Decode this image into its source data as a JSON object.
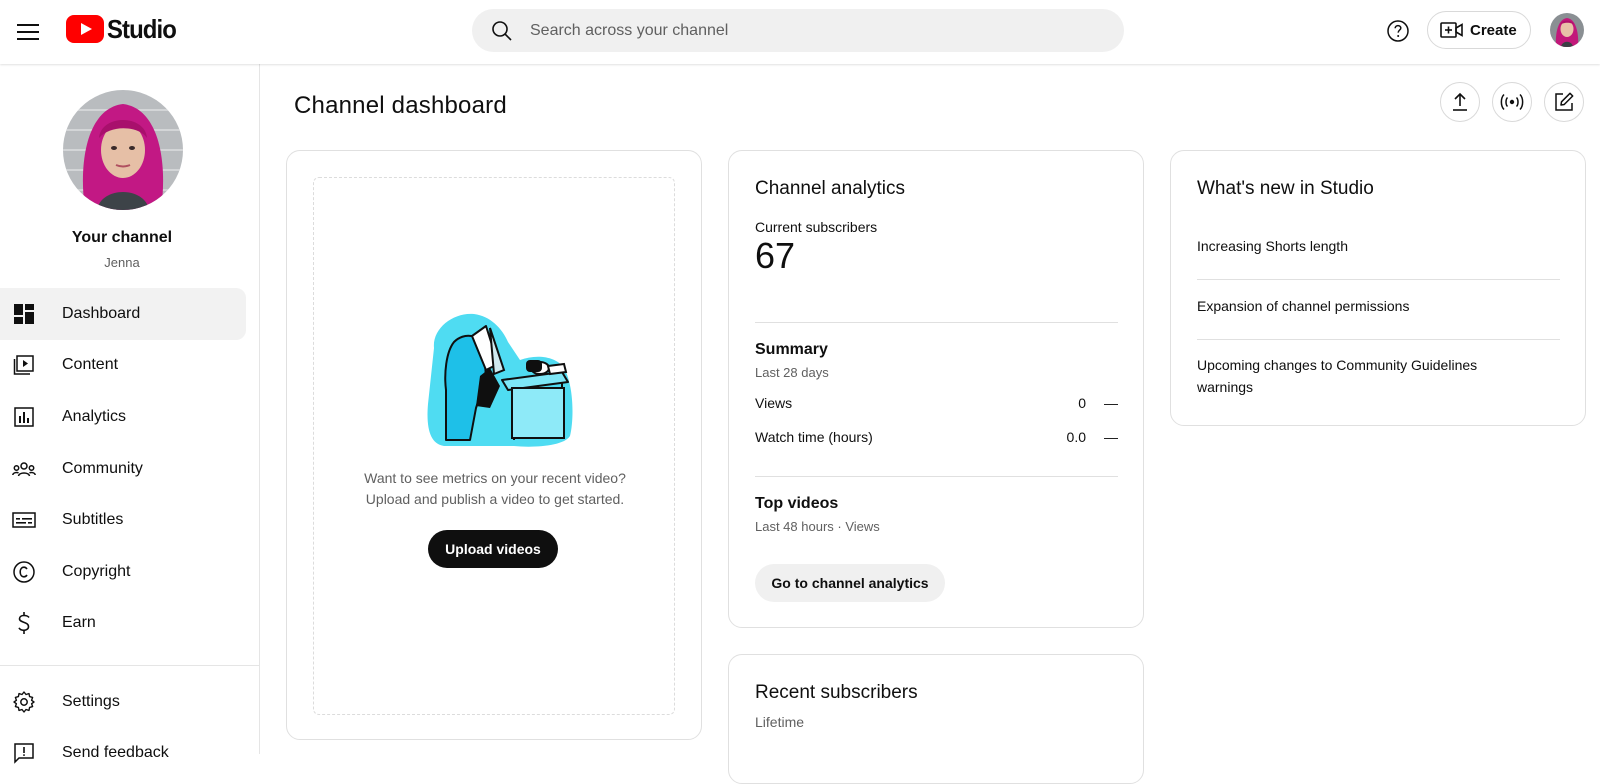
{
  "app": {
    "logo_text": "Studio",
    "brand_red": "#ff0000"
  },
  "search": {
    "placeholder": "Search across your channel"
  },
  "header": {
    "create_label": "Create"
  },
  "sidebar": {
    "channel_title": "Your channel",
    "channel_name": "Jenna",
    "items": [
      {
        "label": "Dashboard",
        "icon": "dashboard-icon",
        "active": true
      },
      {
        "label": "Content",
        "icon": "content-icon"
      },
      {
        "label": "Analytics",
        "icon": "analytics-icon"
      },
      {
        "label": "Community",
        "icon": "community-icon"
      },
      {
        "label": "Subtitles",
        "icon": "subtitles-icon"
      },
      {
        "label": "Copyright",
        "icon": "copyright-icon"
      },
      {
        "label": "Earn",
        "icon": "earn-icon"
      }
    ],
    "bottom_items": [
      {
        "label": "Settings",
        "icon": "gear-icon"
      },
      {
        "label": "Send feedback",
        "icon": "feedback-icon"
      }
    ]
  },
  "main": {
    "title": "Channel dashboard",
    "upload_card": {
      "message_line1": "Want to see metrics on your recent video?",
      "message_line2": "Upload and publish a video to get started.",
      "button": "Upload videos"
    },
    "analytics_card": {
      "title": "Channel analytics",
      "subscribers_label": "Current subscribers",
      "subscribers_value": "67",
      "summary_title": "Summary",
      "summary_period": "Last 28 days",
      "stats": [
        {
          "label": "Views",
          "value": "0",
          "delta": "—"
        },
        {
          "label": "Watch time (hours)",
          "value": "0.0",
          "delta": "—"
        }
      ],
      "top_videos_title": "Top videos",
      "top_videos_period": "Last 48 hours · Views",
      "button": "Go to channel analytics"
    },
    "recent_subscribers_card": {
      "title": "Recent subscribers",
      "period": "Lifetime"
    },
    "news_card": {
      "title": "What's new in Studio",
      "items": [
        "Increasing Shorts length",
        "Expansion of channel permissions",
        "Upcoming changes to Community Guidelines warnings"
      ]
    }
  }
}
